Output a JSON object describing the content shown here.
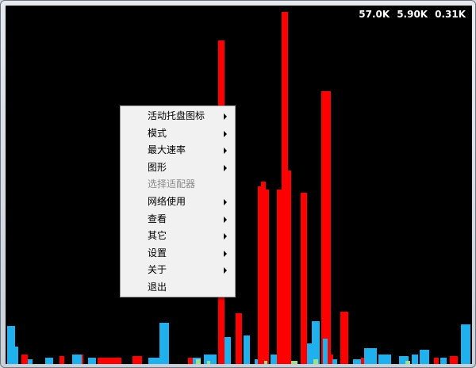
{
  "stats": {
    "v1": "57.0K",
    "v2": "5.90K",
    "v3": "0.31K"
  },
  "menu": {
    "items": [
      {
        "label": "活动托盘图标",
        "arrow": true,
        "enabled": true
      },
      {
        "label": "模式",
        "arrow": true,
        "enabled": true
      },
      {
        "label": "最大速率",
        "arrow": true,
        "enabled": true
      },
      {
        "label": "图形",
        "arrow": true,
        "enabled": true
      },
      {
        "label": "选择适配器",
        "arrow": false,
        "enabled": false
      },
      {
        "label": "网络使用",
        "arrow": true,
        "enabled": true
      },
      {
        "label": "查看",
        "arrow": true,
        "enabled": true
      },
      {
        "label": "其它",
        "arrow": true,
        "enabled": true
      },
      {
        "label": "设置",
        "arrow": true,
        "enabled": true
      },
      {
        "label": "关于",
        "arrow": true,
        "enabled": true
      },
      {
        "label": "退出",
        "arrow": false,
        "enabled": true
      }
    ]
  },
  "colors": {
    "download": "#ff0000",
    "upload": "#1fb1ee",
    "both": "#9be08a",
    "background": "#000000"
  }
}
